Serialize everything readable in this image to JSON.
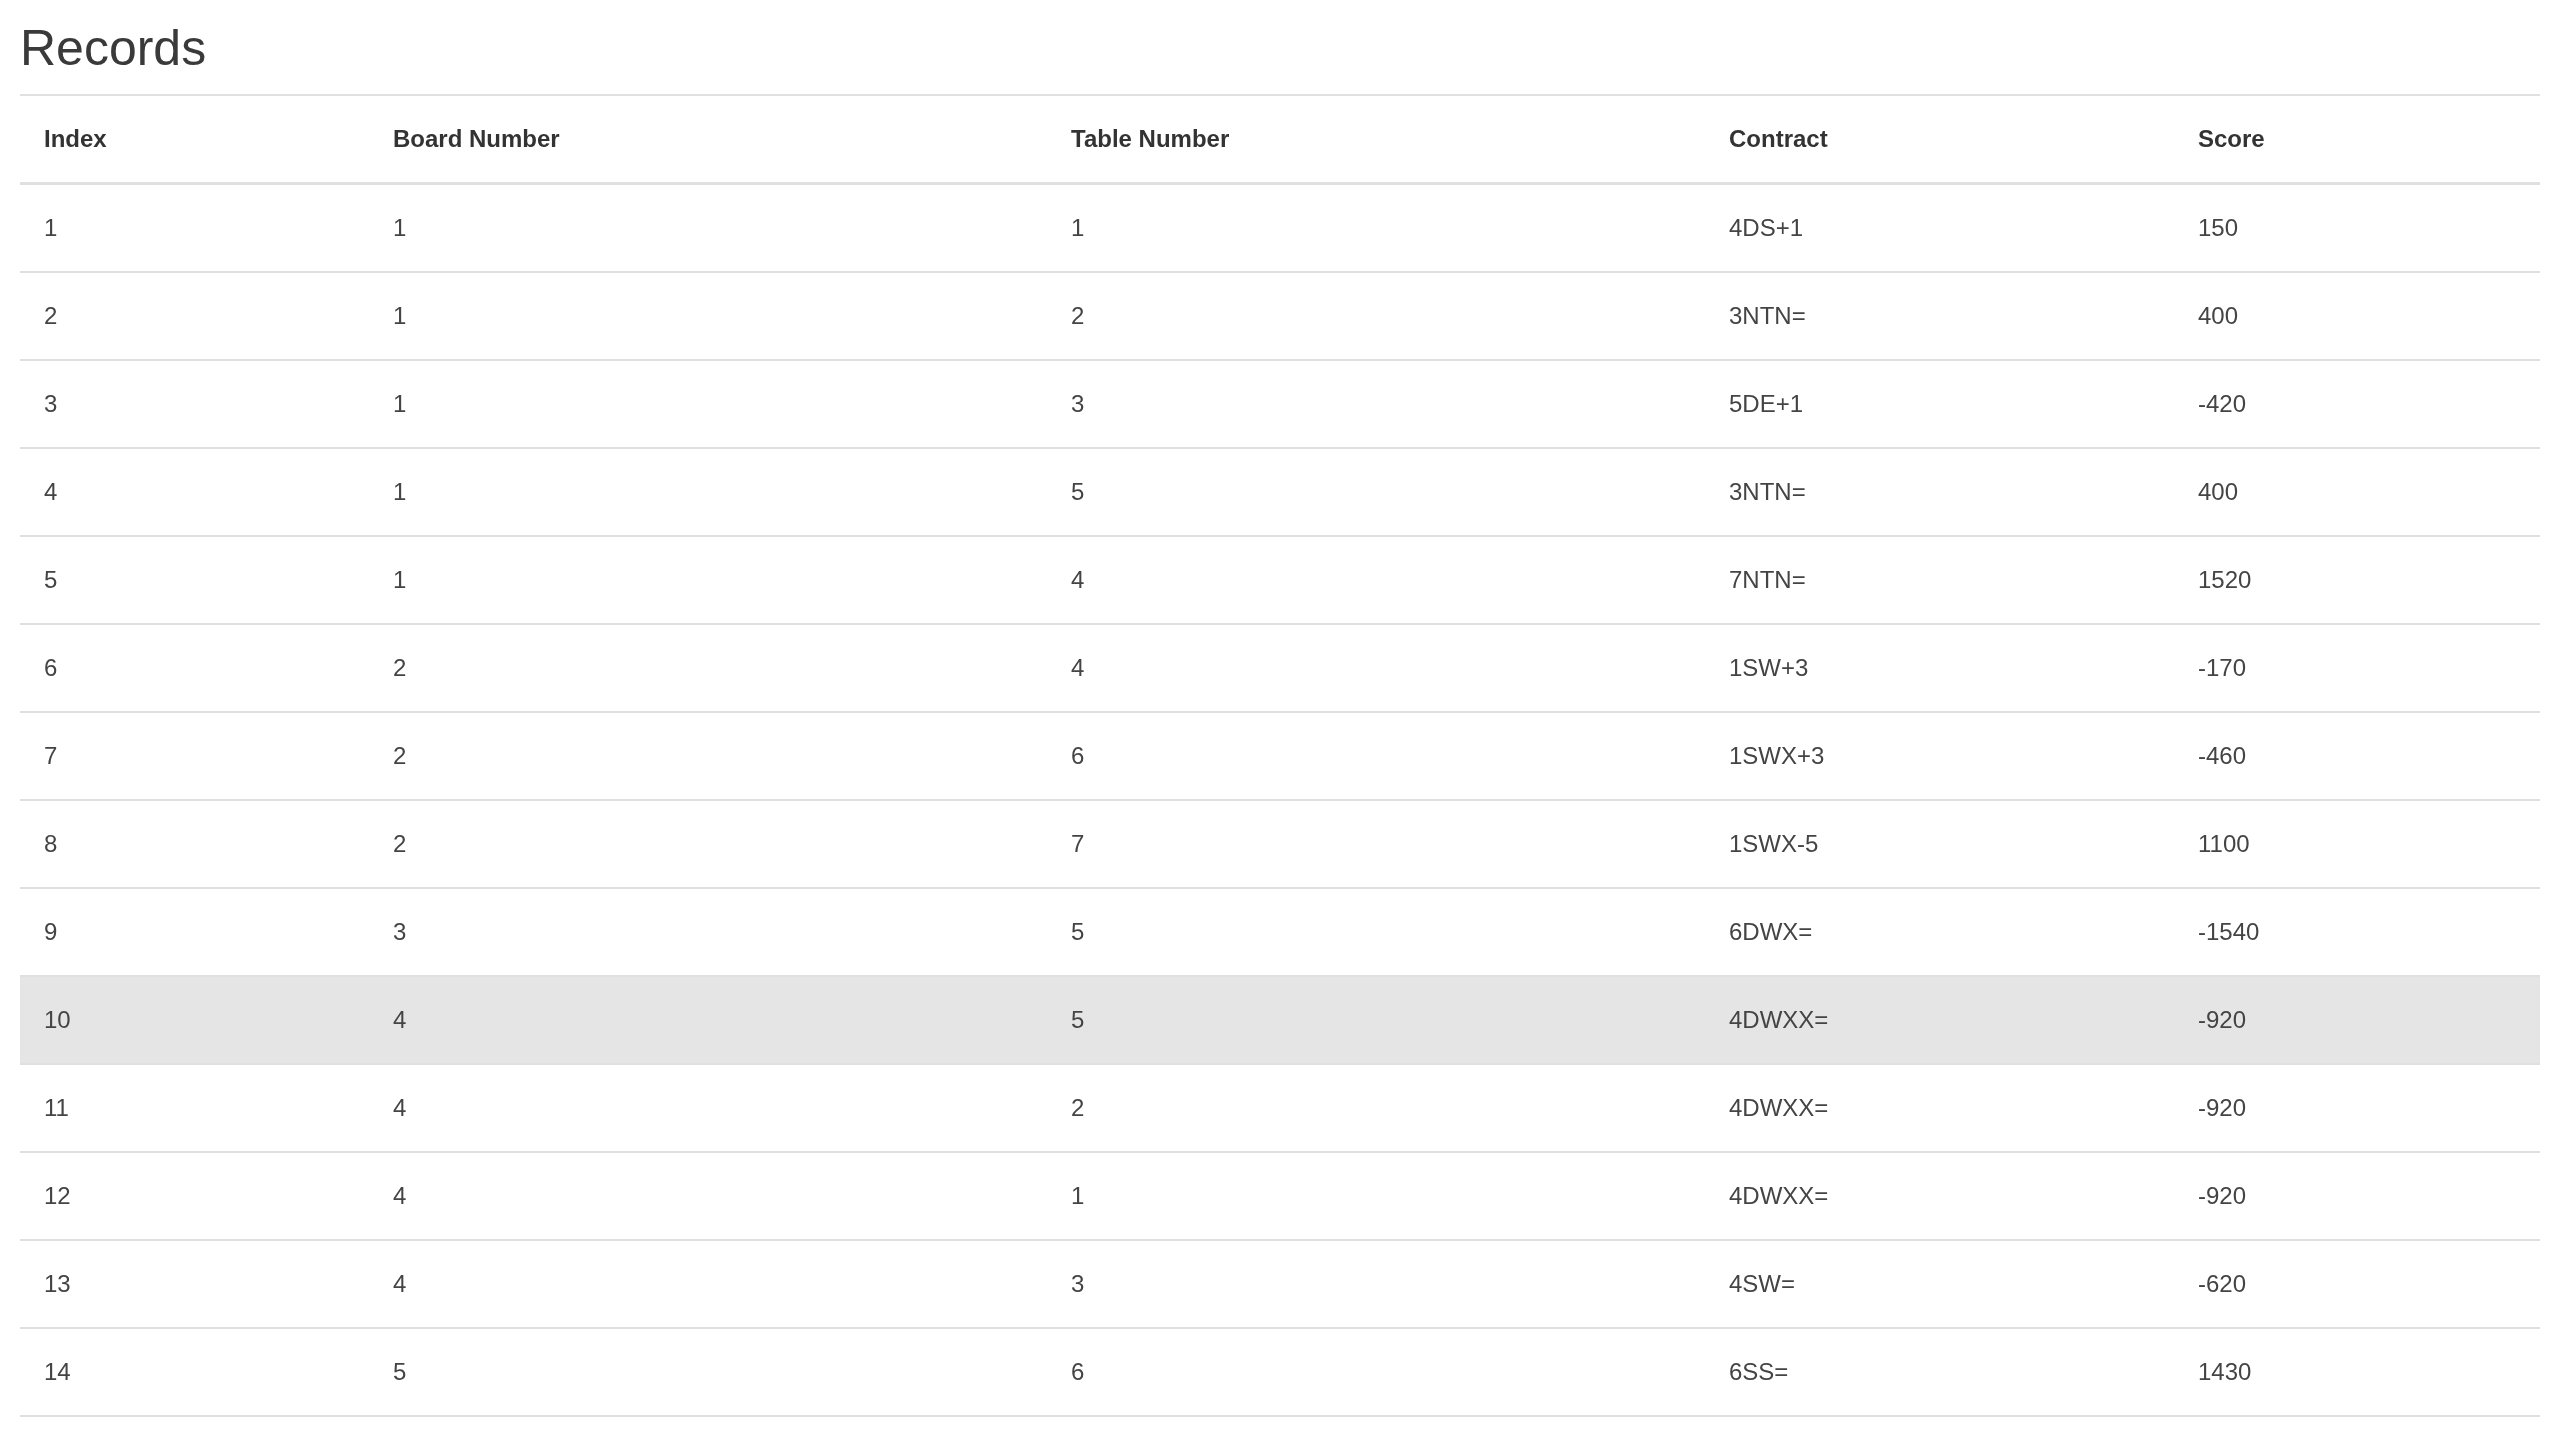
{
  "title": "Records",
  "table": {
    "columns": [
      "Index",
      "Board Number",
      "Table Number",
      "Contract",
      "Score"
    ],
    "rows": [
      {
        "cells": [
          "1",
          "1",
          "1",
          "4DS+1",
          "150"
        ],
        "highlighted": false
      },
      {
        "cells": [
          "2",
          "1",
          "2",
          "3NTN=",
          "400"
        ],
        "highlighted": false
      },
      {
        "cells": [
          "3",
          "1",
          "3",
          "5DE+1",
          "-420"
        ],
        "highlighted": false
      },
      {
        "cells": [
          "4",
          "1",
          "5",
          "3NTN=",
          "400"
        ],
        "highlighted": false
      },
      {
        "cells": [
          "5",
          "1",
          "4",
          "7NTN=",
          "1520"
        ],
        "highlighted": false
      },
      {
        "cells": [
          "6",
          "2",
          "4",
          "1SW+3",
          "-170"
        ],
        "highlighted": false
      },
      {
        "cells": [
          "7",
          "2",
          "6",
          "1SWX+3",
          "-460"
        ],
        "highlighted": false
      },
      {
        "cells": [
          "8",
          "2",
          "7",
          "1SWX-5",
          "1100"
        ],
        "highlighted": false
      },
      {
        "cells": [
          "9",
          "3",
          "5",
          "6DWX=",
          "-1540"
        ],
        "highlighted": false
      },
      {
        "cells": [
          "10",
          "4",
          "5",
          "4DWXX=",
          "-920"
        ],
        "highlighted": true
      },
      {
        "cells": [
          "11",
          "4",
          "2",
          "4DWXX=",
          "-920"
        ],
        "highlighted": false
      },
      {
        "cells": [
          "12",
          "4",
          "1",
          "4DWXX=",
          "-920"
        ],
        "highlighted": false
      },
      {
        "cells": [
          "13",
          "4",
          "3",
          "4SW=",
          "-620"
        ],
        "highlighted": false
      },
      {
        "cells": [
          "14",
          "5",
          "6",
          "6SS=",
          "1430"
        ],
        "highlighted": false
      }
    ]
  }
}
